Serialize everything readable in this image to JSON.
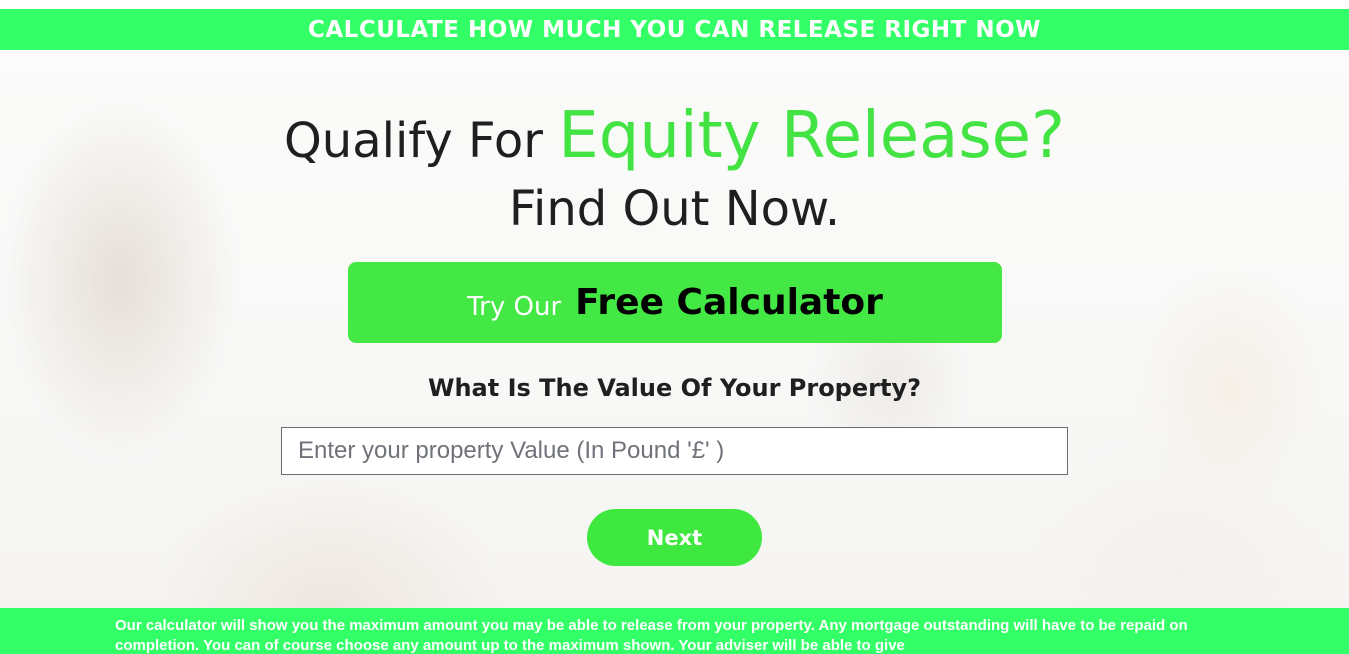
{
  "banner": {
    "text": "CALCULATE HOW MUCH YOU CAN RELEASE RIGHT NOW"
  },
  "headline": {
    "line1_prefix": "Qualify For",
    "line1_accent": "Equity Release?",
    "line2": "Find Out Now."
  },
  "cta": {
    "small_text": "Try Our",
    "big_text": "Free Calculator"
  },
  "form": {
    "question": "What Is The Value Of Your Property?",
    "input_placeholder": "Enter your property Value (In Pound '£' )",
    "input_value": "",
    "next_label": "Next"
  },
  "footer": {
    "disclaimer": "Our calculator will show you the maximum amount you may be able to release from your property. Any mortgage outstanding will have to be repaid on completion. You can of course choose any amount up to the maximum shown. Your  adviser will be able to give"
  },
  "colors": {
    "brand_green": "#33ff66",
    "accent_green": "#44e344",
    "button_green": "#3ee83e"
  }
}
